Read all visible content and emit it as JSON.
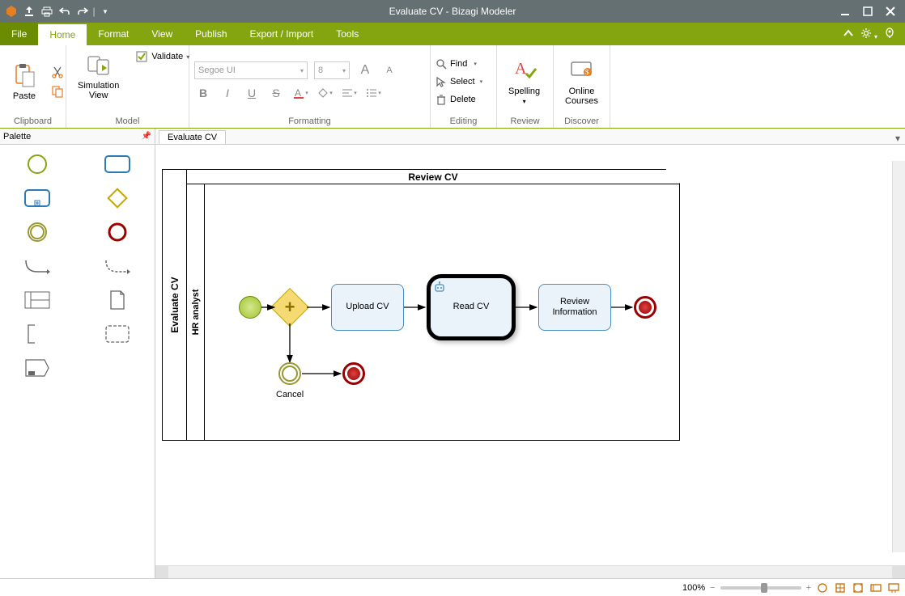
{
  "app": {
    "title": "Evaluate CV - Bizagi Modeler"
  },
  "tabs": {
    "file": "File",
    "items": [
      "Home",
      "Format",
      "View",
      "Publish",
      "Export / Import",
      "Tools"
    ],
    "active": 0
  },
  "ribbon": {
    "clipboard": {
      "label": "Clipboard",
      "paste": "Paste"
    },
    "model": {
      "label": "Model",
      "simulation": "Simulation\nView",
      "validate": "Validate"
    },
    "formatting": {
      "label": "Formatting",
      "font": "Segoe UI",
      "size": "8"
    },
    "editing": {
      "label": "Editing",
      "find": "Find",
      "select": "Select",
      "delete": "Delete"
    },
    "review": {
      "label": "Review",
      "spelling": "Spelling"
    },
    "discover": {
      "label": "Discover",
      "courses": "Online\nCourses"
    }
  },
  "palette": {
    "title": "Palette"
  },
  "document": {
    "tab": "Evaluate CV"
  },
  "diagram": {
    "pool": "Evaluate CV",
    "lane": "HR analyst",
    "lane_title": "Review CV",
    "tasks": {
      "upload": "Upload CV",
      "read": "Read CV",
      "review": "Review\nInformation"
    },
    "cancel": "Cancel"
  },
  "status": {
    "zoom": "100%"
  }
}
